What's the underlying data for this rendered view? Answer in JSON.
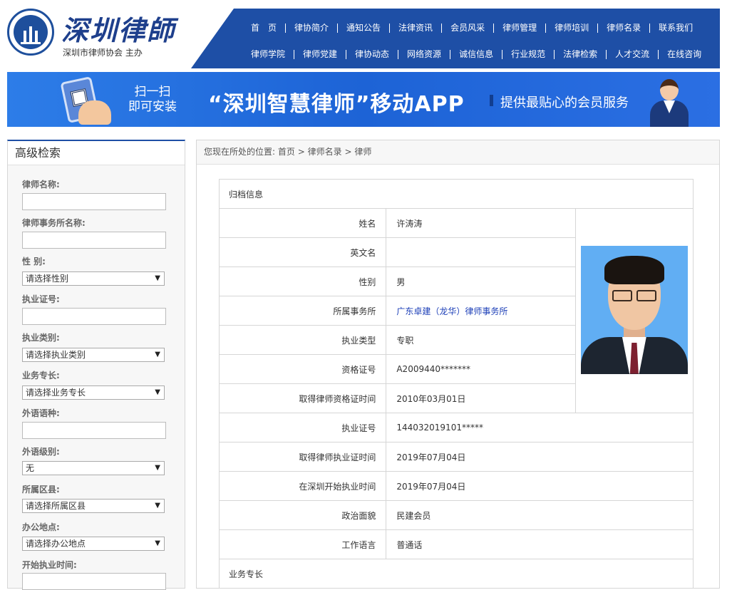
{
  "header": {
    "logo_title": "深圳律師",
    "logo_subtitle": "深圳市律师协会 主办",
    "nav_row1": [
      "首　页",
      "律协简介",
      "通知公告",
      "法律资讯",
      "会员风采",
      "律师管理",
      "律师培训",
      "律师名录",
      "联系我们"
    ],
    "nav_row2": [
      "律师学院",
      "律师党建",
      "律协动态",
      "网络资源",
      "诚信信息",
      "行业规范",
      "法律检索",
      "人才交流",
      "在线咨询"
    ],
    "brand_color": "#1e4fa6"
  },
  "banner": {
    "scan_line1": "扫一扫",
    "scan_line2": "即可安装",
    "title": "“深圳智慧律师”移动APP",
    "tagline": "提供最贴心的会员服务"
  },
  "sidebar": {
    "title": "高级检索",
    "fields": {
      "lawyer_name": "律师名称:",
      "firm_name": "律师事务所名称:",
      "gender": "性 别:",
      "gender_value": "请选择性别",
      "license_no": "执业证号:",
      "practice_type": "执业类别:",
      "practice_type_value": "请选择执业类别",
      "specialty": "业务专长:",
      "specialty_value": "请选择业务专长",
      "language": "外语语种:",
      "language_level": "外语级别:",
      "language_level_value": "无",
      "district": "所属区县:",
      "district_value": "请选择所属区县",
      "office": "办公地点:",
      "office_value": "请选择办公地点",
      "start_time": "开始执业时间:"
    }
  },
  "breadcrumb": {
    "prefix": "您现在所处的位置:",
    "items": [
      "首页",
      "律师名录",
      "律师"
    ],
    "separator": ">"
  },
  "profile": {
    "section_archive": "归档信息",
    "section_specialty": "业务专长",
    "rows": {
      "name": {
        "label": "姓名",
        "value": "许涛涛"
      },
      "english_name": {
        "label": "英文名",
        "value": ""
      },
      "gender": {
        "label": "性别",
        "value": "男"
      },
      "firm": {
        "label": "所属事务所",
        "value": "广东卓建（龙华）律师事务所"
      },
      "practice_type": {
        "label": "执业类型",
        "value": "专职"
      },
      "qualification_no": {
        "label": "资格证号",
        "value": "A2009440*******"
      },
      "qualification_date": {
        "label": "取得律师资格证时间",
        "value": "2010年03月01日"
      },
      "license_no": {
        "label": "执业证号",
        "value": "144032019101*****"
      },
      "license_date": {
        "label": "取得律师执业证时间",
        "value": "2019年07月04日"
      },
      "sz_start_date": {
        "label": "在深圳开始执业时间",
        "value": "2019年07月04日"
      },
      "political_status": {
        "label": "政治面貌",
        "value": "民建会员"
      },
      "work_language": {
        "label": "工作语言",
        "value": "普通话"
      }
    },
    "firm_link_color": "#1e40b8"
  }
}
